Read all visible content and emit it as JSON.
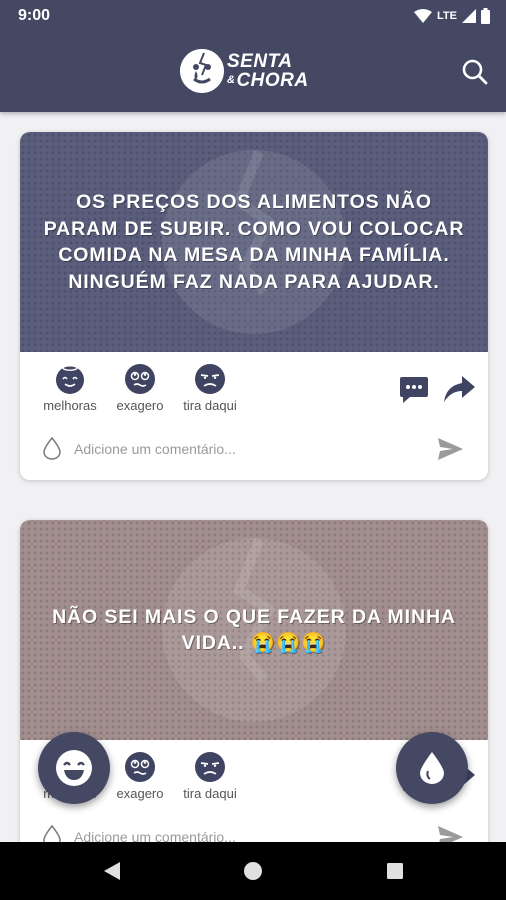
{
  "status_bar": {
    "time": "9:00",
    "network": "LTE"
  },
  "app_bar": {
    "logo_line1": "SENTA",
    "logo_ampersand": "&",
    "logo_line2": "CHORA",
    "search_icon": "search-icon"
  },
  "reactions": [
    {
      "label": "melhoras",
      "icon": "angel-face-icon"
    },
    {
      "label": "exagero",
      "icon": "rolling-eyes-face-icon"
    },
    {
      "label": "tira daqui",
      "icon": "annoyed-face-icon"
    }
  ],
  "posts": [
    {
      "text": "OS PREÇOS DOS ALIMENTOS NÃO PARAM DE SUBIR. COMO VOU COLOCAR COMIDA NA MESA DA MINHA FAMÍLIA. NINGUÉM FAZ NADA PARA AJUDAR.",
      "background": "#5a5e7c",
      "comment_placeholder": "Adicione um comentário..."
    },
    {
      "text": "NÃO SEI MAIS O QUE FAZER DA MINHA VIDA.. 😭😭😭",
      "background": "#a28e8e",
      "comment_placeholder": "Adicione um comentário..."
    }
  ],
  "fabs": {
    "left": "smile-icon",
    "right": "tear-drop-icon"
  },
  "colors": {
    "primary": "#444862",
    "icon": "#3f4462",
    "muted": "#9a9a9a"
  }
}
